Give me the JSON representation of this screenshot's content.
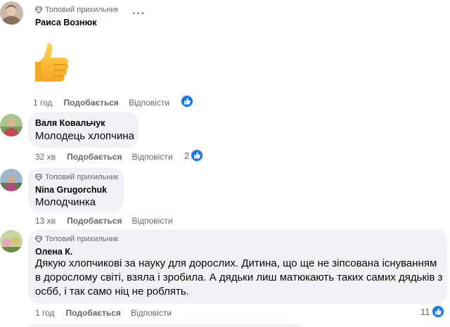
{
  "badge_label": "Топовий прихильник",
  "comments": [
    {
      "author": "Раиса Вознюк",
      "text": "",
      "time": "1 год",
      "like_label": "Подобається",
      "reply_label": "Відповісти",
      "reaction_count": ""
    },
    {
      "author": "Валя Ковальчук",
      "text": "Молодець хлопчина",
      "time": "32 хв",
      "like_label": "Подобається",
      "reply_label": "Відповісти",
      "reaction_count": "2"
    },
    {
      "author": "Nina Grugorchuk",
      "text": "Молодчинка",
      "time": "13 хв",
      "like_label": "Подобається",
      "reply_label": "Відповісти",
      "reaction_count": ""
    },
    {
      "author": "Олена К.",
      "text": "Дякую хлопчикові за науку для дорослих. Дитина, що ще не зіпсована існуванням в дорослому світі, взяла і зробила. А дядьки лиш матюкають таких самих дядьків з осбб, і так само ніц не роблять.",
      "time": "1 год",
      "like_label": "Подобається",
      "reply_label": "Відповісти",
      "reaction_count": "11"
    }
  ],
  "more_options_icon": "more-horizontal-icon",
  "thumbs_up_emoji": "👍",
  "colors": {
    "accent": "#1877f2",
    "bubble": "#f0f2f5",
    "muted": "#65676b"
  }
}
